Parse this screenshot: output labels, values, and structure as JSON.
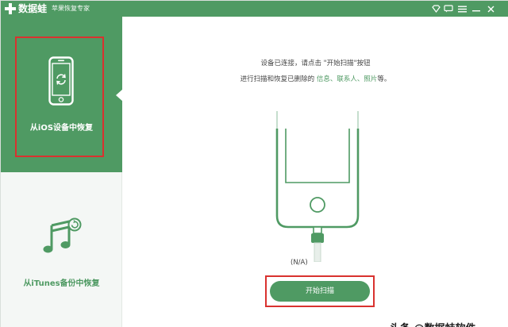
{
  "app": {
    "name": "数据蛙",
    "subtitle": "苹果恢复专家"
  },
  "window_controls": [
    {
      "name": "diamond-icon",
      "glyph": "◆"
    },
    {
      "name": "chat-icon",
      "glyph": "▭"
    },
    {
      "name": "menu-icon",
      "glyph": "≡"
    },
    {
      "name": "minimize-icon",
      "glyph": "—"
    },
    {
      "name": "close-icon",
      "glyph": "✕"
    }
  ],
  "sidebar": {
    "items": [
      {
        "label": "从iOS设备中恢复",
        "icon": "phone-restore-icon",
        "active": true
      },
      {
        "label": "从iTunes备份中恢复",
        "icon": "music-restore-icon",
        "active": false
      }
    ]
  },
  "main": {
    "instruction_line1": {
      "prefix": "设备已连接，请点击 ",
      "quote": "\"开始扫描\"",
      "suffix": "按钮"
    },
    "instruction_line2": {
      "prefix": "进行扫描和恢复已删除的 ",
      "highlight": "信息、联系人、照片",
      "suffix": "等。"
    },
    "status": "(N/A)",
    "scan_button": "开始扫描"
  },
  "watermark": "头条 @数据蛙软件",
  "colors": {
    "accent": "#4f9a63",
    "highlight_border": "#d9322f",
    "sidebar_bg": "#f4f7f5"
  }
}
